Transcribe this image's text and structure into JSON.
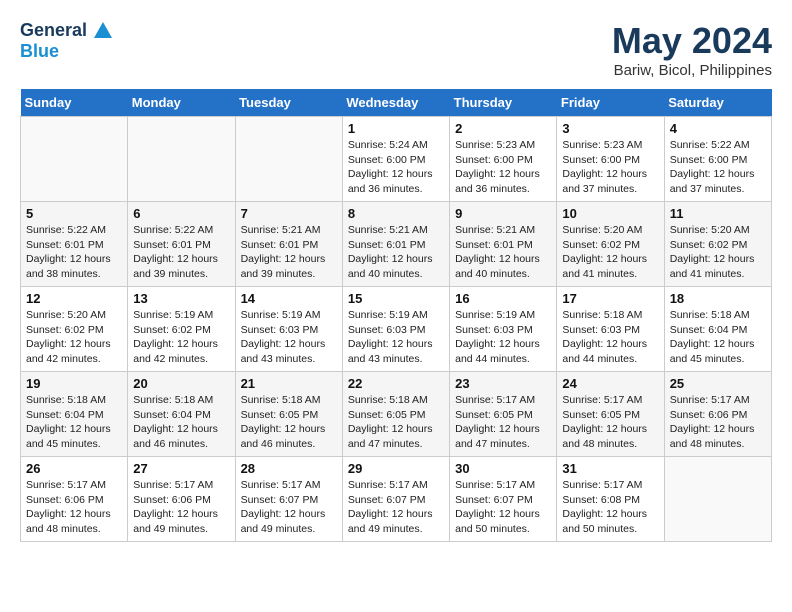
{
  "header": {
    "logo_line1": "General",
    "logo_line2": "Blue",
    "month": "May 2024",
    "location": "Bariw, Bicol, Philippines"
  },
  "weekdays": [
    "Sunday",
    "Monday",
    "Tuesday",
    "Wednesday",
    "Thursday",
    "Friday",
    "Saturday"
  ],
  "weeks": [
    [
      {
        "day": "",
        "sunrise": "",
        "sunset": "",
        "daylight": ""
      },
      {
        "day": "",
        "sunrise": "",
        "sunset": "",
        "daylight": ""
      },
      {
        "day": "",
        "sunrise": "",
        "sunset": "",
        "daylight": ""
      },
      {
        "day": "1",
        "sunrise": "Sunrise: 5:24 AM",
        "sunset": "Sunset: 6:00 PM",
        "daylight": "Daylight: 12 hours and 36 minutes."
      },
      {
        "day": "2",
        "sunrise": "Sunrise: 5:23 AM",
        "sunset": "Sunset: 6:00 PM",
        "daylight": "Daylight: 12 hours and 36 minutes."
      },
      {
        "day": "3",
        "sunrise": "Sunrise: 5:23 AM",
        "sunset": "Sunset: 6:00 PM",
        "daylight": "Daylight: 12 hours and 37 minutes."
      },
      {
        "day": "4",
        "sunrise": "Sunrise: 5:22 AM",
        "sunset": "Sunset: 6:00 PM",
        "daylight": "Daylight: 12 hours and 37 minutes."
      }
    ],
    [
      {
        "day": "5",
        "sunrise": "Sunrise: 5:22 AM",
        "sunset": "Sunset: 6:01 PM",
        "daylight": "Daylight: 12 hours and 38 minutes."
      },
      {
        "day": "6",
        "sunrise": "Sunrise: 5:22 AM",
        "sunset": "Sunset: 6:01 PM",
        "daylight": "Daylight: 12 hours and 39 minutes."
      },
      {
        "day": "7",
        "sunrise": "Sunrise: 5:21 AM",
        "sunset": "Sunset: 6:01 PM",
        "daylight": "Daylight: 12 hours and 39 minutes."
      },
      {
        "day": "8",
        "sunrise": "Sunrise: 5:21 AM",
        "sunset": "Sunset: 6:01 PM",
        "daylight": "Daylight: 12 hours and 40 minutes."
      },
      {
        "day": "9",
        "sunrise": "Sunrise: 5:21 AM",
        "sunset": "Sunset: 6:01 PM",
        "daylight": "Daylight: 12 hours and 40 minutes."
      },
      {
        "day": "10",
        "sunrise": "Sunrise: 5:20 AM",
        "sunset": "Sunset: 6:02 PM",
        "daylight": "Daylight: 12 hours and 41 minutes."
      },
      {
        "day": "11",
        "sunrise": "Sunrise: 5:20 AM",
        "sunset": "Sunset: 6:02 PM",
        "daylight": "Daylight: 12 hours and 41 minutes."
      }
    ],
    [
      {
        "day": "12",
        "sunrise": "Sunrise: 5:20 AM",
        "sunset": "Sunset: 6:02 PM",
        "daylight": "Daylight: 12 hours and 42 minutes."
      },
      {
        "day": "13",
        "sunrise": "Sunrise: 5:19 AM",
        "sunset": "Sunset: 6:02 PM",
        "daylight": "Daylight: 12 hours and 42 minutes."
      },
      {
        "day": "14",
        "sunrise": "Sunrise: 5:19 AM",
        "sunset": "Sunset: 6:03 PM",
        "daylight": "Daylight: 12 hours and 43 minutes."
      },
      {
        "day": "15",
        "sunrise": "Sunrise: 5:19 AM",
        "sunset": "Sunset: 6:03 PM",
        "daylight": "Daylight: 12 hours and 43 minutes."
      },
      {
        "day": "16",
        "sunrise": "Sunrise: 5:19 AM",
        "sunset": "Sunset: 6:03 PM",
        "daylight": "Daylight: 12 hours and 44 minutes."
      },
      {
        "day": "17",
        "sunrise": "Sunrise: 5:18 AM",
        "sunset": "Sunset: 6:03 PM",
        "daylight": "Daylight: 12 hours and 44 minutes."
      },
      {
        "day": "18",
        "sunrise": "Sunrise: 5:18 AM",
        "sunset": "Sunset: 6:04 PM",
        "daylight": "Daylight: 12 hours and 45 minutes."
      }
    ],
    [
      {
        "day": "19",
        "sunrise": "Sunrise: 5:18 AM",
        "sunset": "Sunset: 6:04 PM",
        "daylight": "Daylight: 12 hours and 45 minutes."
      },
      {
        "day": "20",
        "sunrise": "Sunrise: 5:18 AM",
        "sunset": "Sunset: 6:04 PM",
        "daylight": "Daylight: 12 hours and 46 minutes."
      },
      {
        "day": "21",
        "sunrise": "Sunrise: 5:18 AM",
        "sunset": "Sunset: 6:05 PM",
        "daylight": "Daylight: 12 hours and 46 minutes."
      },
      {
        "day": "22",
        "sunrise": "Sunrise: 5:18 AM",
        "sunset": "Sunset: 6:05 PM",
        "daylight": "Daylight: 12 hours and 47 minutes."
      },
      {
        "day": "23",
        "sunrise": "Sunrise: 5:17 AM",
        "sunset": "Sunset: 6:05 PM",
        "daylight": "Daylight: 12 hours and 47 minutes."
      },
      {
        "day": "24",
        "sunrise": "Sunrise: 5:17 AM",
        "sunset": "Sunset: 6:05 PM",
        "daylight": "Daylight: 12 hours and 48 minutes."
      },
      {
        "day": "25",
        "sunrise": "Sunrise: 5:17 AM",
        "sunset": "Sunset: 6:06 PM",
        "daylight": "Daylight: 12 hours and 48 minutes."
      }
    ],
    [
      {
        "day": "26",
        "sunrise": "Sunrise: 5:17 AM",
        "sunset": "Sunset: 6:06 PM",
        "daylight": "Daylight: 12 hours and 48 minutes."
      },
      {
        "day": "27",
        "sunrise": "Sunrise: 5:17 AM",
        "sunset": "Sunset: 6:06 PM",
        "daylight": "Daylight: 12 hours and 49 minutes."
      },
      {
        "day": "28",
        "sunrise": "Sunrise: 5:17 AM",
        "sunset": "Sunset: 6:07 PM",
        "daylight": "Daylight: 12 hours and 49 minutes."
      },
      {
        "day": "29",
        "sunrise": "Sunrise: 5:17 AM",
        "sunset": "Sunset: 6:07 PM",
        "daylight": "Daylight: 12 hours and 49 minutes."
      },
      {
        "day": "30",
        "sunrise": "Sunrise: 5:17 AM",
        "sunset": "Sunset: 6:07 PM",
        "daylight": "Daylight: 12 hours and 50 minutes."
      },
      {
        "day": "31",
        "sunrise": "Sunrise: 5:17 AM",
        "sunset": "Sunset: 6:08 PM",
        "daylight": "Daylight: 12 hours and 50 minutes."
      },
      {
        "day": "",
        "sunrise": "",
        "sunset": "",
        "daylight": ""
      }
    ]
  ]
}
